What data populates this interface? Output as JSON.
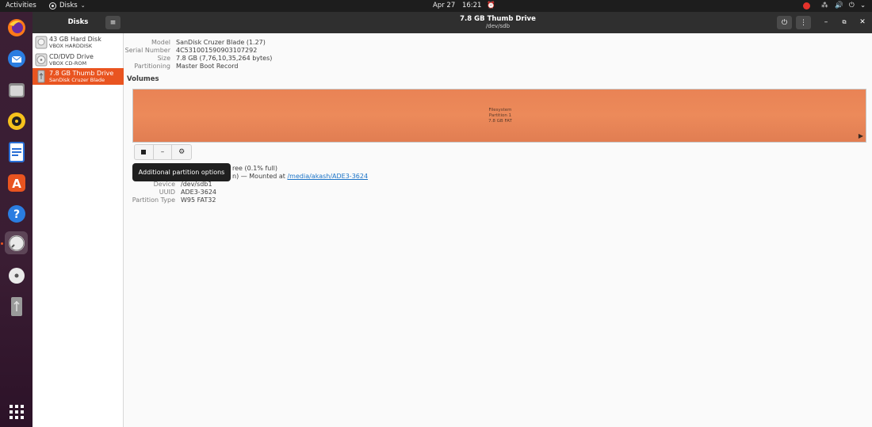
{
  "topbar": {
    "activities": "Activities",
    "app_name": "Disks",
    "date": "Apr 27",
    "time": "16:21"
  },
  "dock": {
    "items": [
      "firefox",
      "thunderbird",
      "files",
      "rhythmbox",
      "libreoffice-writer",
      "app-center",
      "help",
      "disks",
      "optical-drive",
      "usb-drive",
      "show-applications"
    ]
  },
  "sidebar": {
    "title": "Disks",
    "items": [
      {
        "name": "43 GB Hard Disk",
        "sub": "VBOX HARDDISK"
      },
      {
        "name": "CD/DVD Drive",
        "sub": "VBOX CD-ROM"
      },
      {
        "name": "7.8 GB Thumb Drive",
        "sub": "SanDisk Cruzer Blade"
      }
    ]
  },
  "header": {
    "title": "7.8 GB Thumb Drive",
    "subtitle": "/dev/sdb"
  },
  "drive_info": {
    "model_label": "Model",
    "model": "SanDisk Cruzer Blade (1.27)",
    "serial_label": "Serial Number",
    "serial": "4C531001590903107292",
    "size_label": "Size",
    "size": "7.8 GB (7,76,10,35,264 bytes)",
    "partitioning_label": "Partitioning",
    "partitioning": "Master Boot Record"
  },
  "volumes": {
    "title": "Volumes",
    "bar_line1": "Filesystem",
    "bar_line2": "Partition 1",
    "bar_line3": "7.8 GB FAT"
  },
  "partition": {
    "size_fragment": "ree (0.1% full)",
    "contents_fragment": "n) — Mounted at",
    "mount_link": "/media/akash/ADE3-3624",
    "device_label": "Device",
    "device": "/dev/sdb1",
    "uuid_label": "UUID",
    "uuid": "ADE3-3624",
    "type_label": "Partition Type",
    "type": "W95 FAT32"
  },
  "tooltip": "Additional partition options",
  "colors": {
    "accent": "#e95420",
    "volume_fill": "#ec8a5a",
    "headerbar": "#2f2f2f"
  }
}
